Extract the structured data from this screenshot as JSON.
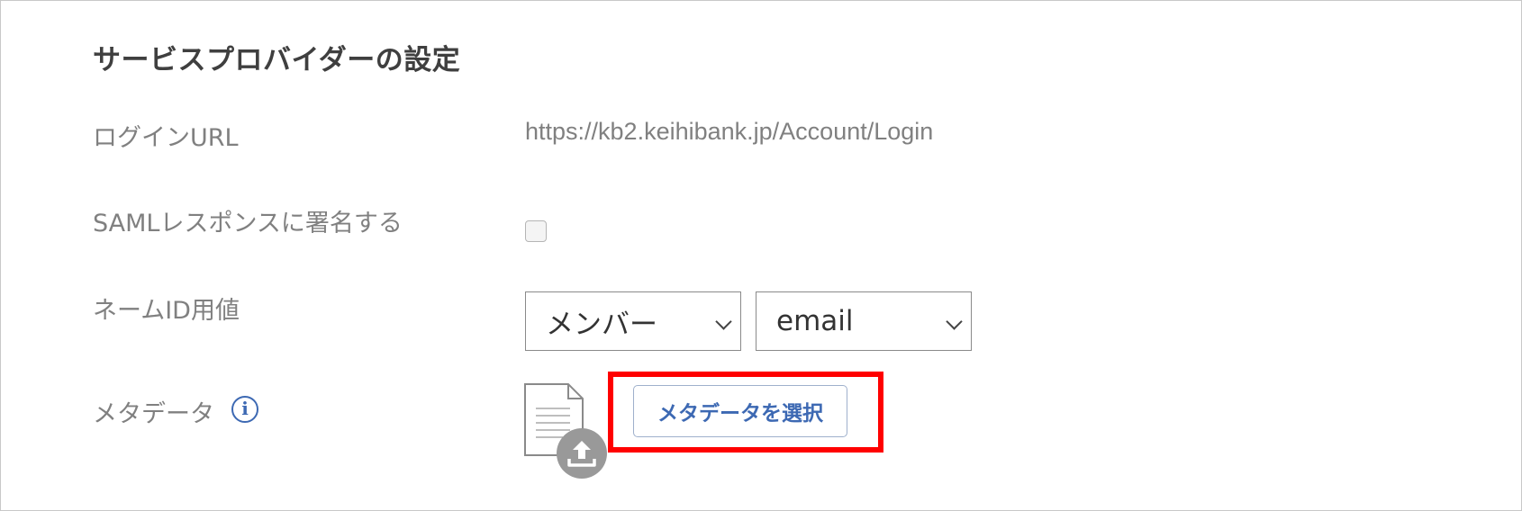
{
  "section": {
    "title": "サービスプロバイダーの設定"
  },
  "login_url": {
    "label": "ログインURL",
    "value": "https://kb2.keihibank.jp/Account/Login"
  },
  "saml_sign": {
    "label": "SAMLレスポンスに署名する",
    "checked": false
  },
  "name_id": {
    "label": "ネームID用値",
    "select1_value": "メンバー",
    "select2_value": "email"
  },
  "metadata": {
    "label": "メタデータ",
    "info_icon_glyph": "i",
    "select_button_label": "メタデータを選択",
    "document_icon": "document-icon",
    "upload_icon": "upload-icon"
  },
  "colors": {
    "accent": "#3d69b3",
    "highlight": "#ff0000",
    "label_text": "#808080",
    "title_text": "#3f3f3f"
  }
}
